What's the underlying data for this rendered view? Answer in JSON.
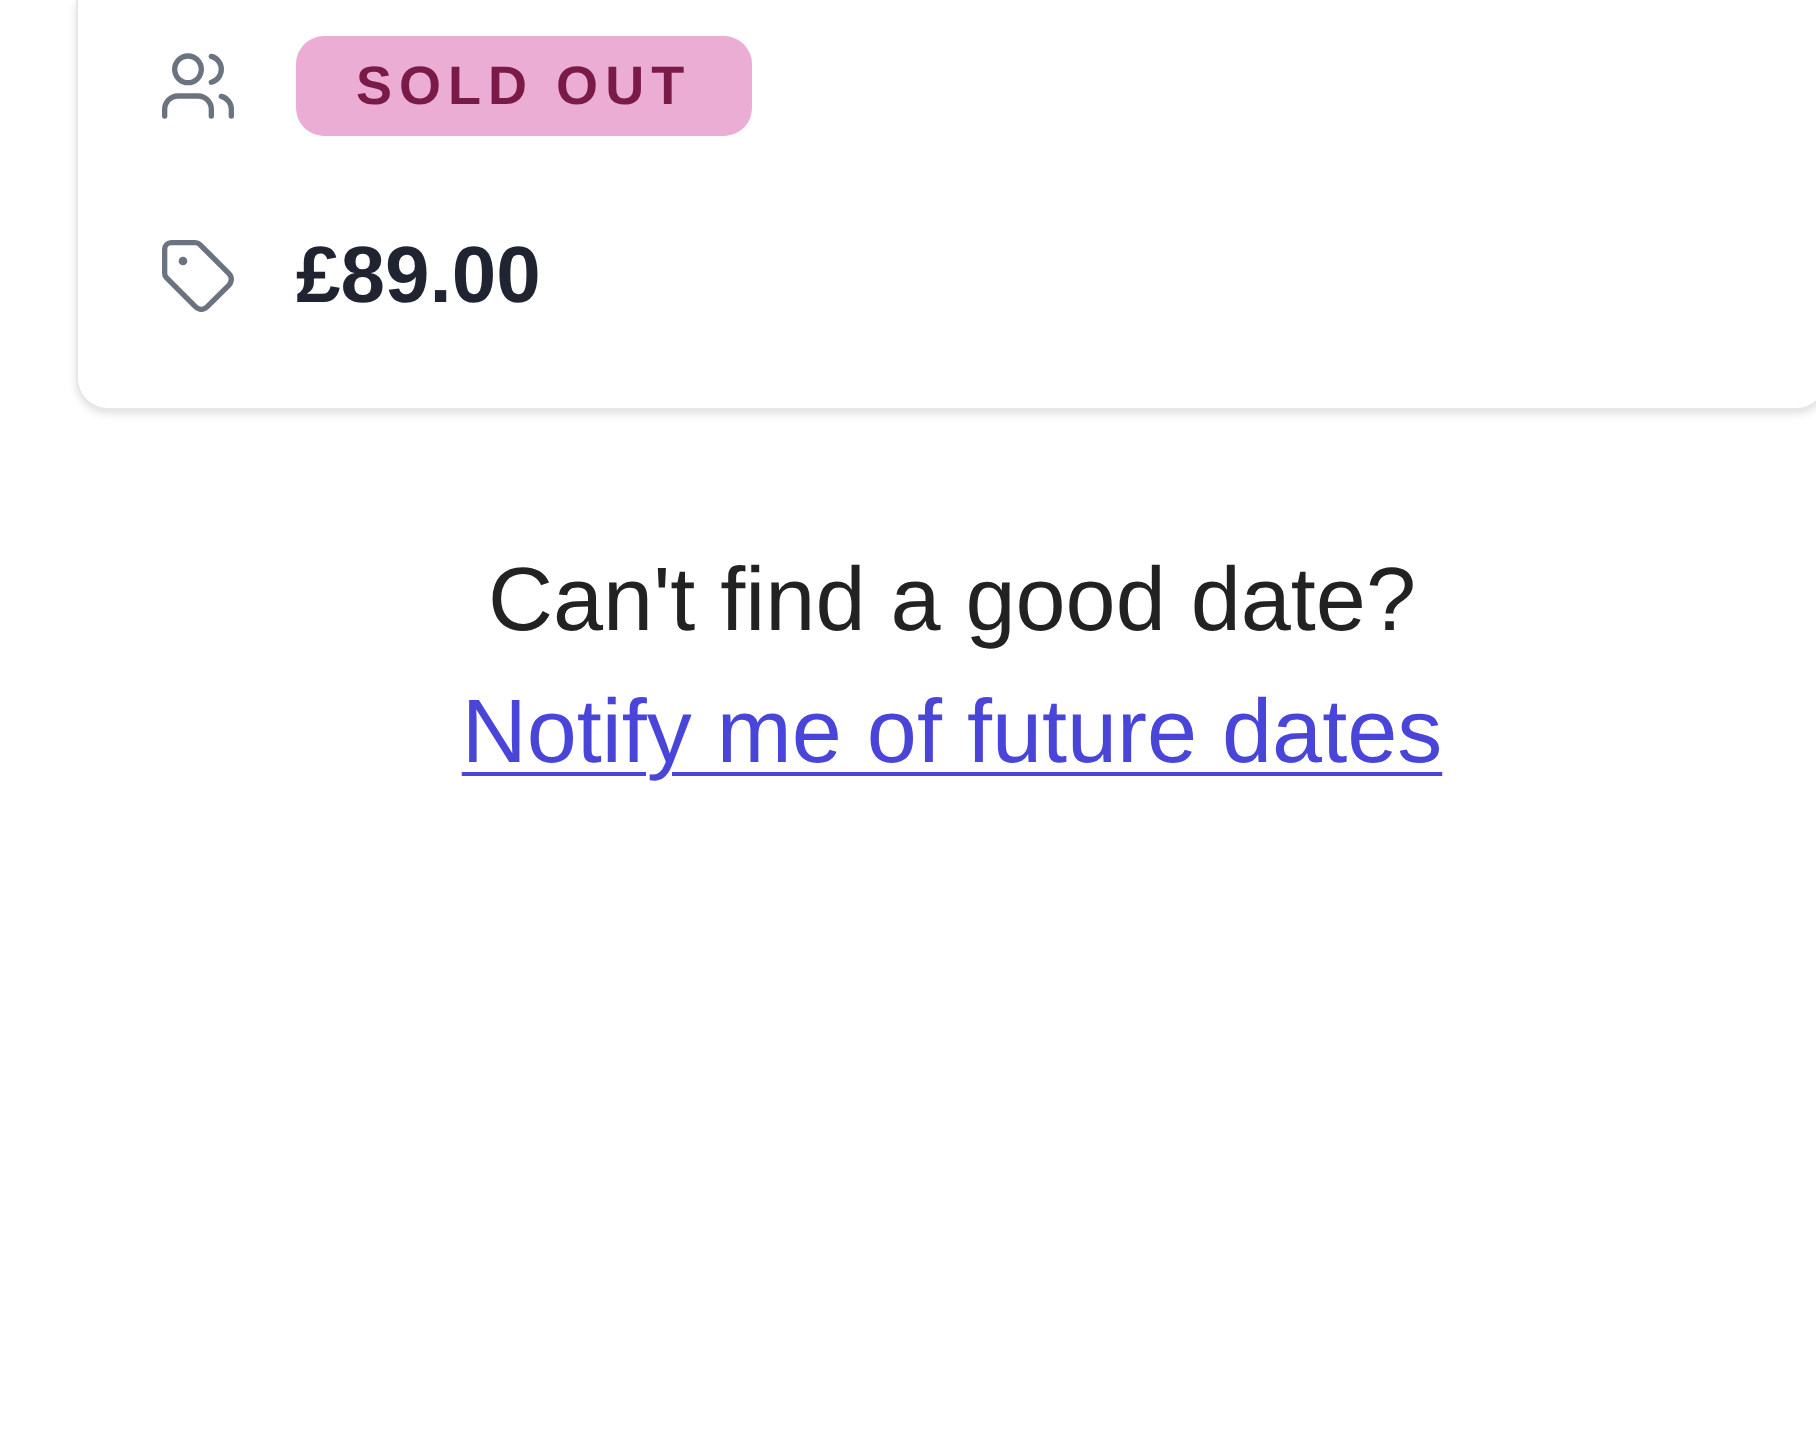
{
  "details": [
    {
      "kind": "badge",
      "text": "SOLD OUT"
    },
    {
      "kind": "price",
      "text": "£89.00"
    }
  ],
  "footer": {
    "prompt": "Can't find a good date?",
    "link": "Notify me of future dates"
  }
}
